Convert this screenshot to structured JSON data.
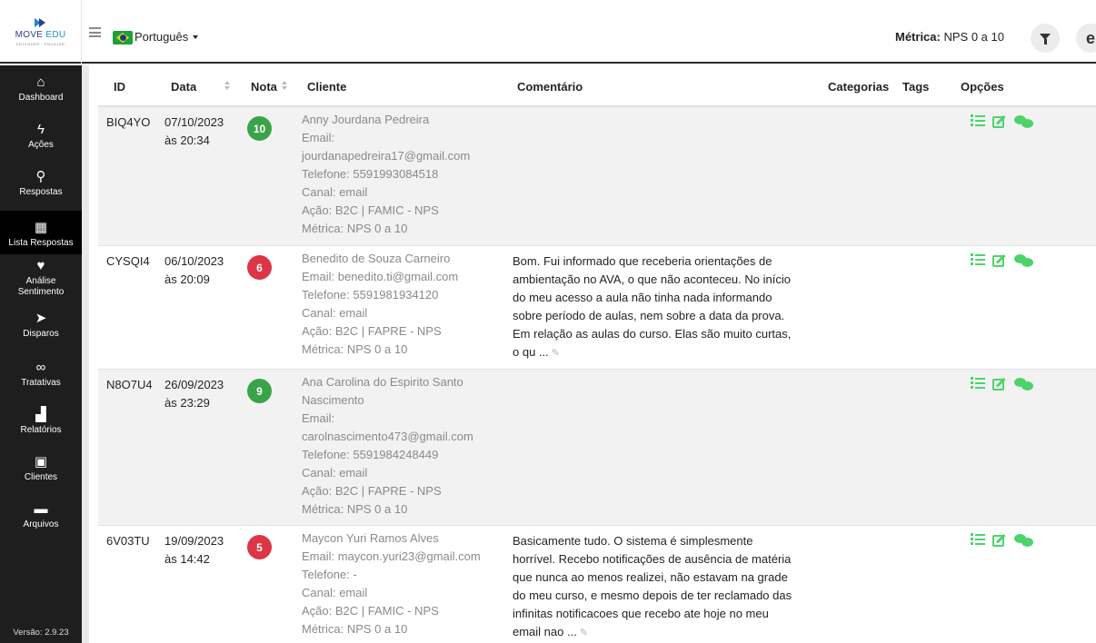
{
  "brand": {
    "name_main": "MOVE",
    "name_accent": "EDU",
    "tagline": "ENTENDER · ENGAJAR"
  },
  "header": {
    "language": "Português",
    "metric_label": "Métrica:",
    "metric_value": "NPS 0 a 10",
    "user_initial": "e"
  },
  "sidebar": {
    "items": [
      {
        "label": "Dashboard",
        "icon": "home-icon"
      },
      {
        "label": "Ações",
        "icon": "bolt-icon"
      },
      {
        "label": "Respostas",
        "icon": "search-icon"
      },
      {
        "label": "Lista Respostas",
        "icon": "table-icon"
      },
      {
        "label_line1": "Análise",
        "label_line2": "Sentimento",
        "icon": "heart-hand-icon"
      },
      {
        "label": "Disparos",
        "icon": "paper-plane-icon"
      },
      {
        "label": "Tratativas",
        "icon": "infinity-icon"
      },
      {
        "label": "Relatórios",
        "icon": "bar-chart-icon"
      },
      {
        "label": "Clientes",
        "icon": "contact-book-icon"
      },
      {
        "label": "Arquivos",
        "icon": "archive-icon"
      }
    ],
    "version": "Versão: 2.9.23"
  },
  "table": {
    "columns": {
      "id": "ID",
      "data": "Data",
      "nota": "Nota",
      "cliente": "Cliente",
      "comentario": "Comentário",
      "categorias": "Categorias",
      "tags": "Tags",
      "opcoes": "Opções"
    },
    "rows": [
      {
        "id": "BIQ4YO",
        "date": "07/10/2023",
        "time": "às 20:34",
        "score": "10",
        "score_color": "#3aa34a",
        "client_lines": [
          "Anny Jourdana Pedreira",
          "Email:",
          "jourdanapedreira17@gmail.com",
          "Telefone: 5591993084518",
          "Canal: email",
          "Ação: B2C | FAMIC - NPS",
          "Métrica: NPS 0 a 10"
        ],
        "comment_lines": []
      },
      {
        "id": "CYSQI4",
        "date": "06/10/2023",
        "time": "às 20:09",
        "score": "6",
        "score_color": "#dc3545",
        "client_lines": [
          "Benedito de Souza Carneiro",
          "Email: benedito.ti@gmail.com",
          "Telefone: 5591981934120",
          "Canal: email",
          "Ação: B2C | FAPRE - NPS",
          "Métrica: NPS 0 a 10"
        ],
        "comment_lines": [
          "Bom. Fui informado que receberia orientações de",
          "ambientação no AVA, o que não aconteceu. No início",
          "do meu acesso a aula não tinha nada informando",
          "sobre período de aulas, nem sobre a data da prova.",
          "Em relação as aulas do curso. Elas são muito curtas,",
          "o qu ..."
        ]
      },
      {
        "id": "N8O7U4",
        "date": "26/09/2023",
        "time": "às 23:29",
        "score": "9",
        "score_color": "#3aa34a",
        "client_lines": [
          "Ana Carolina do Espirito Santo",
          "Nascimento",
          "Email:",
          "carolnascimento473@gmail.com",
          "Telefone: 5591984248449",
          "Canal: email",
          "Ação: B2C | FAPRE - NPS",
          "Métrica: NPS 0 a 10"
        ],
        "comment_lines": []
      },
      {
        "id": "6V03TU",
        "date": "19/09/2023",
        "time": "às 14:42",
        "score": "5",
        "score_color": "#dc3545",
        "client_lines": [
          "Maycon Yuri Ramos Alves",
          "Email: maycon.yuri23@gmail.com",
          "Telefone: -",
          "Canal: email",
          "Ação: B2C | FAMIC - NPS",
          "Métrica: NPS 0 a 10"
        ],
        "comment_lines": [
          "Basicamente tudo. O sistema é simplesmente",
          "horrível. Recebo notificações de ausência de matéria",
          "que nunca ao menos realizei, não estavam na grade",
          "do meu curso, e mesmo depois de ter reclamado das",
          "infinitas notificacoes que recebo ate hoje no meu",
          "email nao ..."
        ]
      }
    ]
  }
}
